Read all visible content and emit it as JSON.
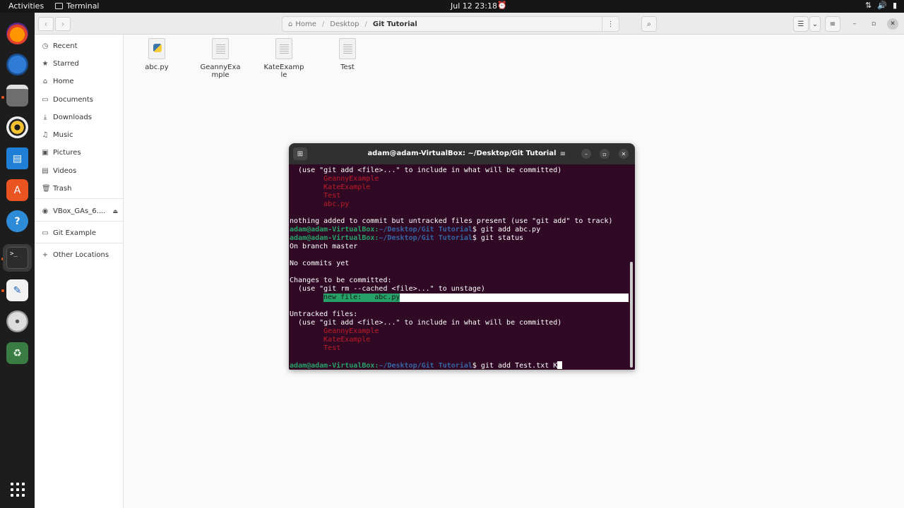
{
  "topbar": {
    "activities": "Activities",
    "app_name": "Terminal",
    "clock": "Jul 12  23:18"
  },
  "files": {
    "path": [
      "Home",
      "Desktop",
      "Git Tutorial"
    ],
    "sidebar": [
      {
        "label": "Recent",
        "icon": "clock-icon"
      },
      {
        "label": "Starred",
        "icon": "star-icon"
      },
      {
        "label": "Home",
        "icon": "home-icon"
      },
      {
        "label": "Documents",
        "icon": "document-icon"
      },
      {
        "label": "Downloads",
        "icon": "download-icon"
      },
      {
        "label": "Music",
        "icon": "music-icon"
      },
      {
        "label": "Pictures",
        "icon": "picture-icon"
      },
      {
        "label": "Videos",
        "icon": "video-icon"
      },
      {
        "label": "Trash",
        "icon": "trash-icon"
      },
      {
        "label": "VBox_GAs_6....",
        "icon": "disc-icon"
      },
      {
        "label": "Git Example",
        "icon": "folder-icon"
      },
      {
        "label": "Other Locations",
        "icon": "plus-icon"
      }
    ],
    "items": [
      {
        "name": "abc.py",
        "type": "python"
      },
      {
        "name": "GeannyExa\nmple",
        "type": "text"
      },
      {
        "name": "KateExamp\nle",
        "type": "text"
      },
      {
        "name": "Test",
        "type": "text"
      }
    ]
  },
  "terminal": {
    "title": "adam@adam-VirtualBox: ~/Desktop/Git Tutorial",
    "prompt_user": "adam@adam-VirtualBox:",
    "prompt_path": "~/Desktop/Git Tutorial",
    "lines": {
      "l1": "  (use \"git add <file>...\" to include in what will be committed)",
      "u1": "        GeannyExample",
      "u2": "        KateExample",
      "u3": "        Test",
      "u4": "        abc.py",
      "nothing": "nothing added to commit but untracked files present (use \"git add\" to track)",
      "cmd1": "$ git add abc.py",
      "cmd2": "$ git status",
      "branch": "On branch master",
      "nocommits": "No commits yet",
      "changes": "Changes to be committed:",
      "unstage": "  (use \"git rm --cached <file>...\" to unstage)",
      "newfile": "new file:   abc.py",
      "untracked": "Untracked files:",
      "l2": "  (use \"git add <file>...\" to include in what will be committed)",
      "r1": "        GeannyExample",
      "r2": "        KateExample",
      "r3": "        Test",
      "cmd3": "$ git add Test.txt K"
    }
  }
}
